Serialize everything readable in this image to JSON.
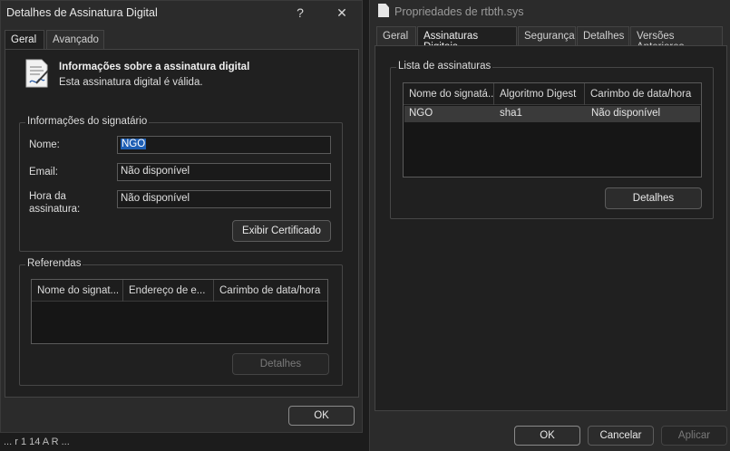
{
  "left_dialog": {
    "title": "Detalhes de Assinatura Digital",
    "help_glyph": "?",
    "close_glyph": "✕",
    "tabs": [
      {
        "label": "Geral"
      },
      {
        "label": "Avançado"
      }
    ],
    "info": {
      "heading": "Informações sobre a assinatura digital",
      "subtext": "Esta assinatura digital é válida."
    },
    "signer_group": {
      "title": "Informações do signatário",
      "name_label": "Nome:",
      "name_value": "NGO",
      "email_label": "Email:",
      "email_value": "Não disponível",
      "time_label_1": "Hora da",
      "time_label_2": "assinatura:",
      "time_value": "Não disponível",
      "view_cert_button": "Exibir Certificado"
    },
    "countersig_group": {
      "title": "Referendas",
      "columns": [
        "Nome do signat...",
        "Endereço de e...",
        "Carimbo de data/hora"
      ],
      "details_button": "Detalhes"
    },
    "ok_button": "OK"
  },
  "right_dialog": {
    "title": "Propriedades de rtbth.sys",
    "tabs": [
      {
        "label": "Geral"
      },
      {
        "label": "Assinaturas Digitais"
      },
      {
        "label": "Segurança"
      },
      {
        "label": "Detalhes"
      },
      {
        "label": "Versões Anteriores"
      }
    ],
    "signature_group": {
      "title": "Lista de assinaturas",
      "columns": [
        "Nome do signatá...",
        "Algoritmo Digest",
        "Carimbo de data/hora"
      ],
      "rows": [
        {
          "name": "NGO",
          "digest": "sha1",
          "timestamp": "Não disponível"
        }
      ],
      "details_button": "Detalhes"
    },
    "ok_button": "OK",
    "cancel_button": "Cancelar",
    "apply_button": "Aplicar"
  },
  "underlay_text": "... r 1 14 A R ..."
}
